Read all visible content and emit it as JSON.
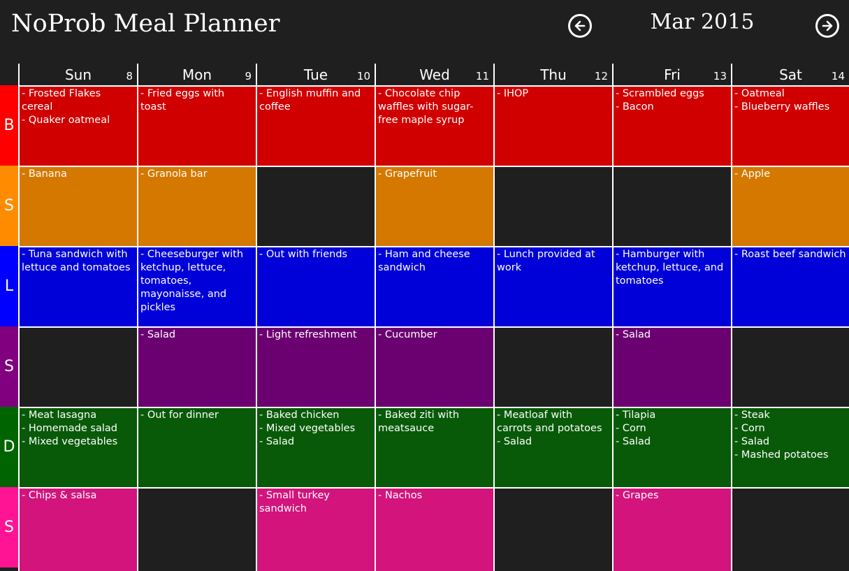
{
  "header": {
    "app_title": "NoProb Meal Planner",
    "month": "Mar 2015",
    "prev_icon": "arrow-left-circle-icon",
    "next_icon": "arrow-right-circle-icon"
  },
  "days": [
    {
      "name": "Sun",
      "date": "8"
    },
    {
      "name": "Mon",
      "date": "9"
    },
    {
      "name": "Tue",
      "date": "10"
    },
    {
      "name": "Wed",
      "date": "11"
    },
    {
      "name": "Thu",
      "date": "12"
    },
    {
      "name": "Fri",
      "date": "13"
    },
    {
      "name": "Sat",
      "date": "14"
    }
  ],
  "meals": [
    {
      "label": "B",
      "label_color": "#ff0000",
      "cell_color": "#d10000",
      "cells": [
        [
          "- Frosted Flakes cereal",
          "- Quaker oatmeal"
        ],
        [
          "- Fried eggs with toast"
        ],
        [
          "- English muffin and coffee"
        ],
        [
          "- Chocolate chip waffles with sugar-free maple syrup"
        ],
        [
          "- IHOP"
        ],
        [
          "- Scrambled eggs",
          "- Bacon"
        ],
        [
          "- Oatmeal",
          "- Blueberry waffles"
        ]
      ]
    },
    {
      "label": "S",
      "label_color": "#ff8c00",
      "cell_color": "#d47800",
      "cells": [
        [
          "- Banana"
        ],
        [
          "- Granola bar"
        ],
        [],
        [
          "- Grapefruit"
        ],
        [],
        [],
        [
          "- Apple"
        ]
      ]
    },
    {
      "label": "L",
      "label_color": "#0000ff",
      "cell_color": "#0000d8",
      "cells": [
        [
          "- Tuna sandwich with lettuce and tomatoes"
        ],
        [
          "- Cheeseburger with ketchup, lettuce, tomatoes, mayonaisse, and pickles"
        ],
        [
          "- Out with friends"
        ],
        [
          "- Ham and cheese sandwich"
        ],
        [
          "- Lunch provided at work"
        ],
        [
          "- Hamburger with ketchup, lettuce, and tomatoes"
        ],
        [
          "- Roast beef sandwich"
        ]
      ]
    },
    {
      "label": "S",
      "label_color": "#800080",
      "cell_color": "#6b0070",
      "cells": [
        [],
        [
          "- Salad"
        ],
        [
          "- Light refreshment"
        ],
        [
          "- Cucumber"
        ],
        [],
        [
          "- Salad"
        ],
        []
      ]
    },
    {
      "label": "D",
      "label_color": "#006400",
      "cell_color": "#085a08",
      "cells": [
        [
          "- Meat lasagna",
          "- Homemade salad",
          "- Mixed vegetables"
        ],
        [
          "- Out for dinner"
        ],
        [
          "- Baked chicken",
          "- Mixed vegetables",
          "- Salad"
        ],
        [
          "- Baked ziti with meatsauce"
        ],
        [
          "- Meatloaf with carrots and potatoes",
          "- Salad"
        ],
        [
          "- Tilapia",
          "- Corn",
          "- Salad"
        ],
        [
          "- Steak",
          "- Corn",
          "- Salad",
          "- Mashed potatoes"
        ]
      ]
    },
    {
      "label": "S",
      "label_color": "#ff1493",
      "cell_color": "#d2147c",
      "cells": [
        [
          "- Chips & salsa"
        ],
        [],
        [
          "- Small turkey sandwich"
        ],
        [
          "- Nachos"
        ],
        [],
        [
          "- Grapes"
        ],
        []
      ]
    }
  ],
  "empty_cell_color": "#1f1f1f"
}
